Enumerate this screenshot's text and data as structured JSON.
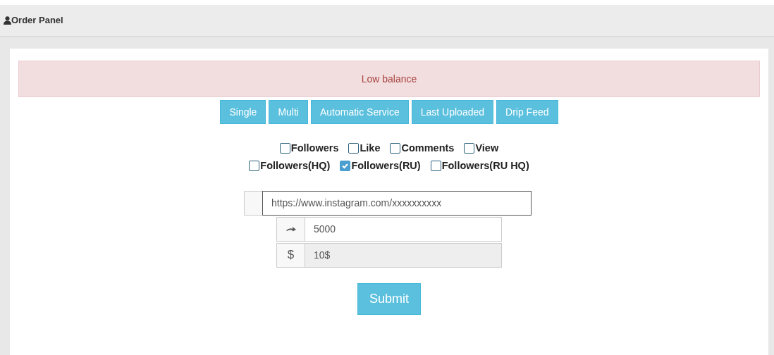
{
  "header": {
    "title": "Order Panel"
  },
  "alert": {
    "text": "Low balance"
  },
  "tabs": [
    {
      "label": "Single"
    },
    {
      "label": "Multi"
    },
    {
      "label": "Automatic Service"
    },
    {
      "label": "Last Uploaded"
    },
    {
      "label": "Drip Feed"
    }
  ],
  "option_rows": [
    [
      {
        "label": "Followers",
        "checked": false
      },
      {
        "label": "Like",
        "checked": false
      },
      {
        "label": "Comments",
        "checked": false
      },
      {
        "label": "View",
        "checked": false
      }
    ],
    [
      {
        "label": "Followers(HQ)",
        "checked": false
      },
      {
        "label": "Followers(RU)",
        "checked": true
      },
      {
        "label": "Followers(RU HQ)",
        "checked": false
      }
    ]
  ],
  "fields": [
    {
      "kind": "link",
      "value": "https://www.instagram.com/xxxxxxxxxx",
      "focused": true,
      "disabled": false
    },
    {
      "kind": "quantity",
      "value": "5000",
      "focused": false,
      "disabled": false
    },
    {
      "kind": "price",
      "prefix": "$",
      "value": "10$",
      "focused": false,
      "disabled": true
    }
  ],
  "submit": {
    "label": "Submit"
  }
}
